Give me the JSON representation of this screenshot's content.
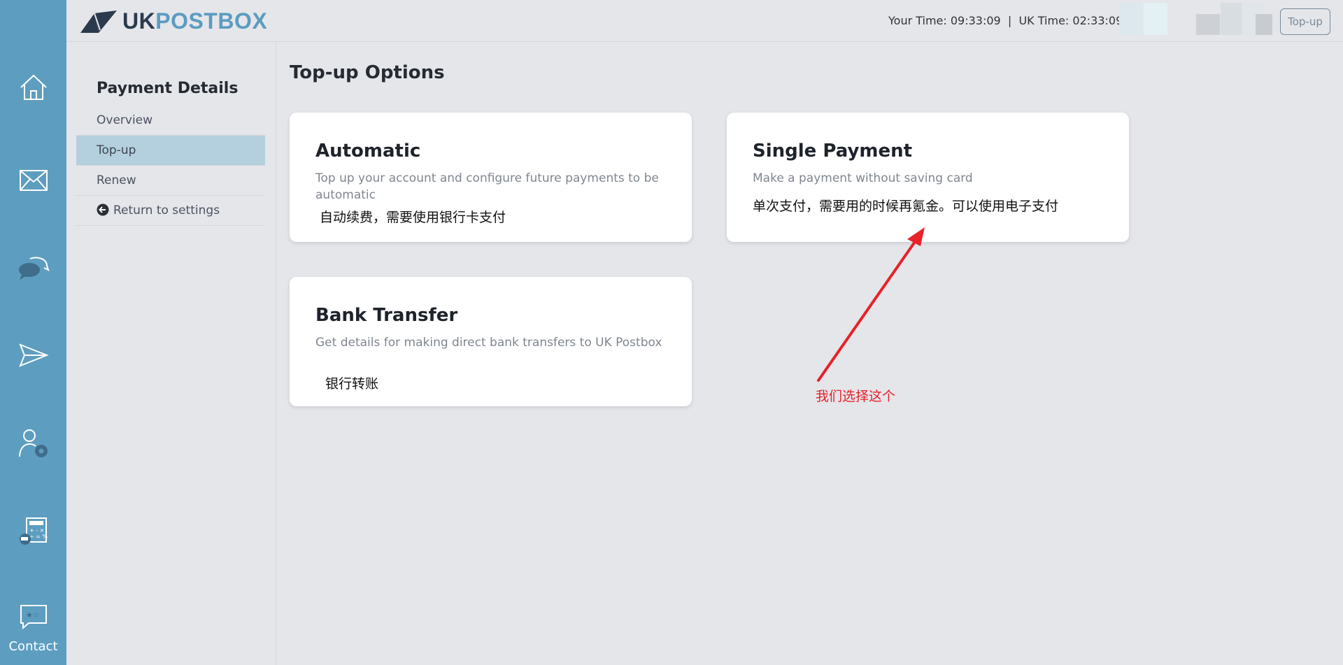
{
  "rail": {
    "contact_label": "Contact",
    "icons": [
      "home-icon",
      "mail-icon",
      "chat-icon",
      "send-icon",
      "user-settings-icon",
      "calculator-icon",
      "feedback-icon"
    ],
    "color": "#5d9dc0"
  },
  "header": {
    "logo_uk": "UK",
    "logo_postbox": "POSTBOX",
    "clock": "Your Time: 09:33:09  |  UK Time: 02:33:09",
    "topup_button": "Top-up"
  },
  "subnav": {
    "title": "Payment Details",
    "items": [
      {
        "label": "Overview",
        "active": false
      },
      {
        "label": "Top-up",
        "active": true
      },
      {
        "label": "Renew",
        "active": false
      },
      {
        "label": "Return to settings",
        "active": false
      }
    ]
  },
  "main": {
    "title": "Top-up Options",
    "cards": [
      {
        "title": "Automatic",
        "description": "Top up your account and configure future payments to be automatic",
        "note": "自动续费，需要使用银行卡支付"
      },
      {
        "title": "Single Payment",
        "description": "Make a payment without saving card",
        "note": "单次支付，需要用的时候再氪金。可以使用电子支付"
      },
      {
        "title": "Bank Transfer",
        "description": "Get details for making direct bank transfers to UK Postbox",
        "note": "银行转账"
      }
    ]
  },
  "annotation": {
    "label": "我们选择这个",
    "color": "#e8212a"
  }
}
